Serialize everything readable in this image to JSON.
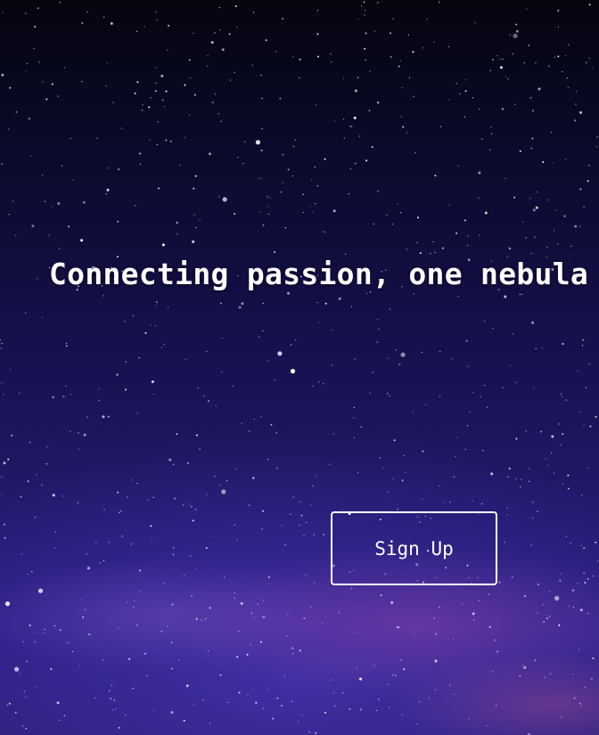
{
  "hero": {
    "headline": "Connecting passion, one nebula at a time",
    "cta_label": "Sign Up"
  },
  "colors": {
    "text": "#ffffff",
    "sky_top": "#05050f",
    "sky_bottom": "#2b1f80",
    "nebula_glow": "#9646aa"
  }
}
